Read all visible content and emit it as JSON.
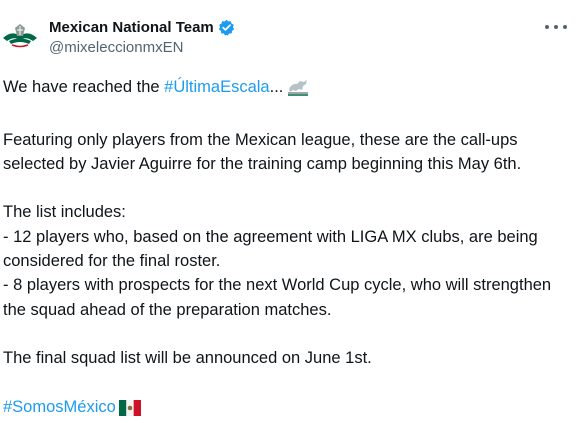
{
  "author": {
    "display_name": "Mexican National Team",
    "handle": "@mixeleccionmxEN"
  },
  "icons": {
    "avatar": "mexico-federation-logo",
    "verified": "verified-badge-icon",
    "more": "more-options-icon",
    "race_emoji": "racing-horse-emoji",
    "flag_emoji": "mexico-flag-emoji"
  },
  "tweet": {
    "line1_prefix": "We have reached the ",
    "hashtag1": "#ÚltimaEscala",
    "ellipsis": "...",
    "p2": "Featuring only players from the Mexican league, these are the call-ups selected by Javier Aguirre for the training camp beginning this May 6th.",
    "p3_heading": "The list includes:",
    "p3_item1": "- 12 players who, based on the agreement with LIGA MX clubs, are being considered for the final roster.",
    "p3_item2": "- 8 players with prospects for the next World Cup cycle, who will strengthen the squad ahead of the preparation matches.",
    "p4": "The final squad list will be announced on June 1st.",
    "hashtag2": "#SomosMéxico"
  },
  "colors": {
    "link": "#1d9bf0",
    "text": "#0f1419",
    "secondary": "#536471",
    "mexico_green": "#006847",
    "mexico_red": "#ce1126"
  }
}
